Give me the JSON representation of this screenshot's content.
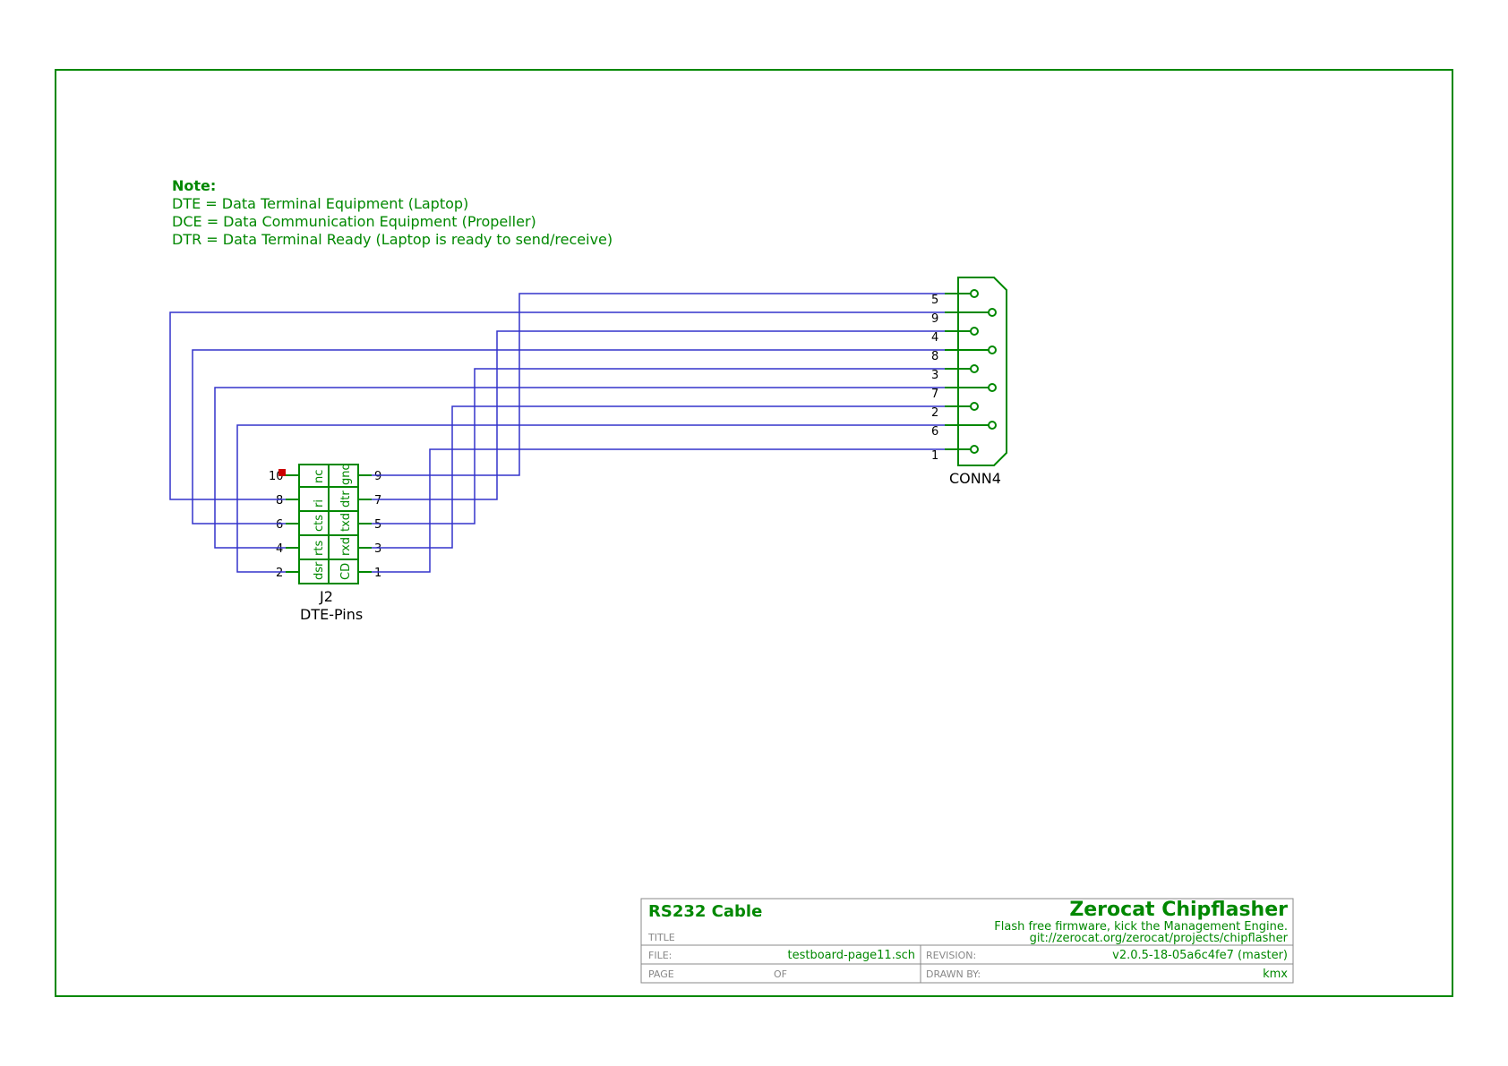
{
  "note": {
    "title": "Note:",
    "line1": "DTE = Data Terminal Equipment (Laptop)",
    "line2": "DCE = Data Communication Equipment (Propeller)",
    "line3": "DTR = Data Terminal Ready (Laptop is ready to send/receive)"
  },
  "j2": {
    "ref": "J2",
    "name": "DTE-Pins",
    "pins": {
      "p1": "1",
      "p2": "2",
      "p3": "3",
      "p4": "4",
      "p5": "5",
      "p6": "6",
      "p7": "7",
      "p8": "8",
      "p9": "9",
      "p10": "10",
      "n1": "CD",
      "n2": "dsr",
      "n3": "rxd",
      "n4": "rts",
      "n5": "txd",
      "n6": "cts",
      "n7": "dtr",
      "n8": "ri",
      "n9": "gnd",
      "n10": "nc"
    }
  },
  "conn4": {
    "ref": "CONN4",
    "pins": {
      "p1": "1",
      "p2": "2",
      "p3": "3",
      "p4": "4",
      "p5": "5",
      "p6": "6",
      "p7": "7",
      "p8": "8",
      "p9": "9"
    }
  },
  "titleblock": {
    "title": "RS232 Cable",
    "project": "Zerocat Chipflasher",
    "tagline": "Flash free firmware, kick the Management Engine.",
    "url": "git://zerocat.org/zerocat/projects/chipflasher",
    "label_title": "TITLE",
    "label_file": "FILE:",
    "file": "testboard-page11.sch",
    "label_rev": "REVISION:",
    "rev": "v2.0.5-18-05a6c4fe7 (master)",
    "label_page": "PAGE",
    "label_of": "OF",
    "label_drawn": "DRAWN BY:",
    "drawn": "kmx"
  }
}
